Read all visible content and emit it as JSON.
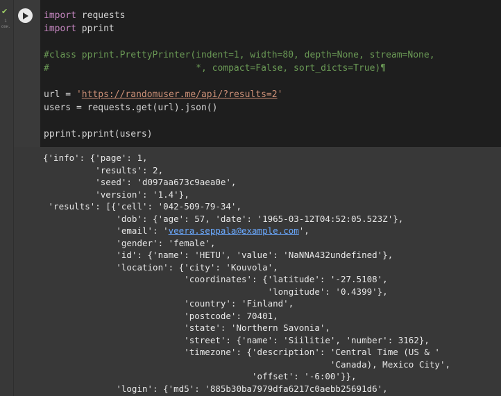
{
  "gutter": {
    "status_icon": "check-icon",
    "exec_count": "1",
    "exec_unit": "сек."
  },
  "run_button": {
    "icon": "play-icon"
  },
  "code": {
    "line1": [
      "import",
      " requests"
    ],
    "line2": [
      "import",
      " pprint"
    ],
    "comment1": "#class pprint.PrettyPrinter(indent=1, width=80, depth=None, stream=None,",
    "comment2": "#                           *, compact=False, sort_dicts=True)¶",
    "url_prefix": "url = ",
    "url_quote_open": "'",
    "url_value": "https://randomuser.me/api/?results=2",
    "url_quote_close": "'",
    "users_line": "users = requests.get(url).json()",
    "pprint_line": "pprint.pprint(users)"
  },
  "output": {
    "lines": [
      "{'info': {'page': 1,",
      "          'results': 2,",
      "          'seed': 'd097aa673c9aea0e',",
      "          'version': '1.4'},",
      " 'results': [{'cell': '042-509-79-34',",
      "              'dob': {'age': 57, 'date': '1965-03-12T04:52:05.523Z'},"
    ],
    "email_prefix": "              'email': '",
    "email_value": "veera.seppala@example.com",
    "email_suffix": "',",
    "lines_after": [
      "              'gender': 'female',",
      "              'id': {'name': 'HETU', 'value': 'NaNNA432undefined'},",
      "              'location': {'city': 'Kouvola',",
      "                           'coordinates': {'latitude': '-27.5108',",
      "                                           'longitude': '0.4399'},",
      "                           'country': 'Finland',",
      "                           'postcode': 70401,",
      "                           'state': 'Northern Savonia',",
      "                           'street': {'name': 'Siilitie', 'number': 3162},",
      "                           'timezone': {'description': 'Central Time (US & '",
      "                                                       'Canada), Mexico City',",
      "                                        'offset': '-6:00'}},",
      "              'login': {'md5': '885b30ba7979dfa6217c0aebb25691d6',"
    ]
  }
}
